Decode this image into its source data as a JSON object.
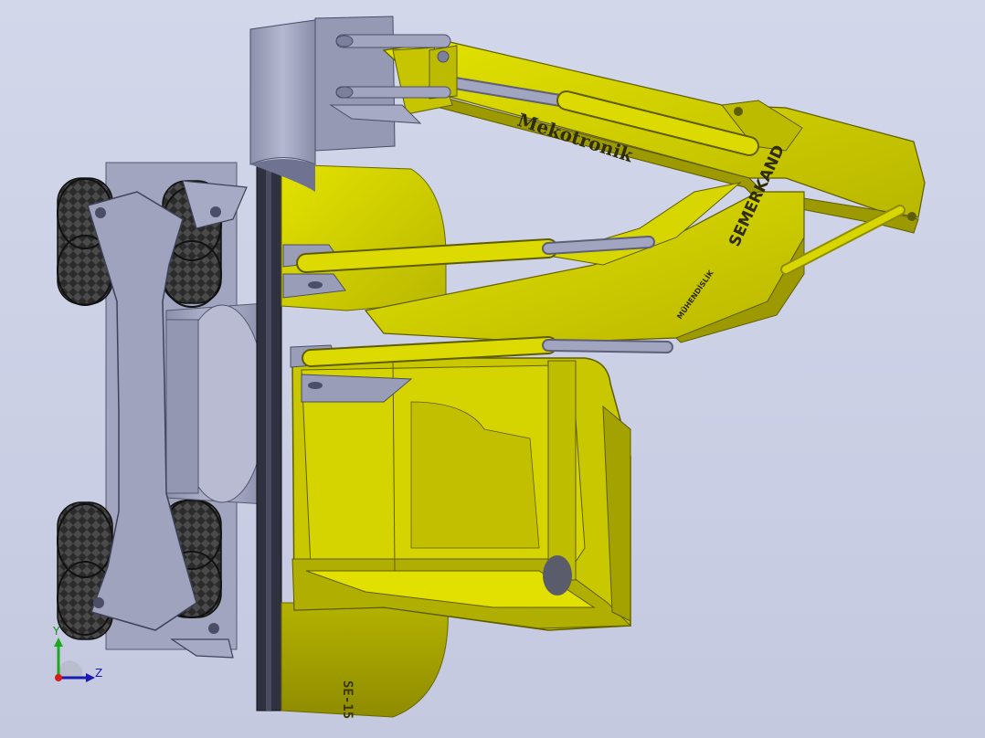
{
  "viewport": {
    "background_top": "#d3d7ea",
    "background_bottom": "#c5c9e0"
  },
  "model": {
    "arm_brand": "Mekotronik",
    "boom_brand": "SEMERKAND",
    "boom_subtext": "MÜHENDİSLİK",
    "base_marking": "SE-15",
    "colors": {
      "yellow": "#cfcd00",
      "yellow_dark": "#8f8c00",
      "gray": "#9a9db8",
      "gray_dark": "#6f7290",
      "tire": "#2b2b2b"
    }
  },
  "triad": {
    "y_label": "Y",
    "z_label": "Z",
    "icon": "axis-triad-icon"
  }
}
